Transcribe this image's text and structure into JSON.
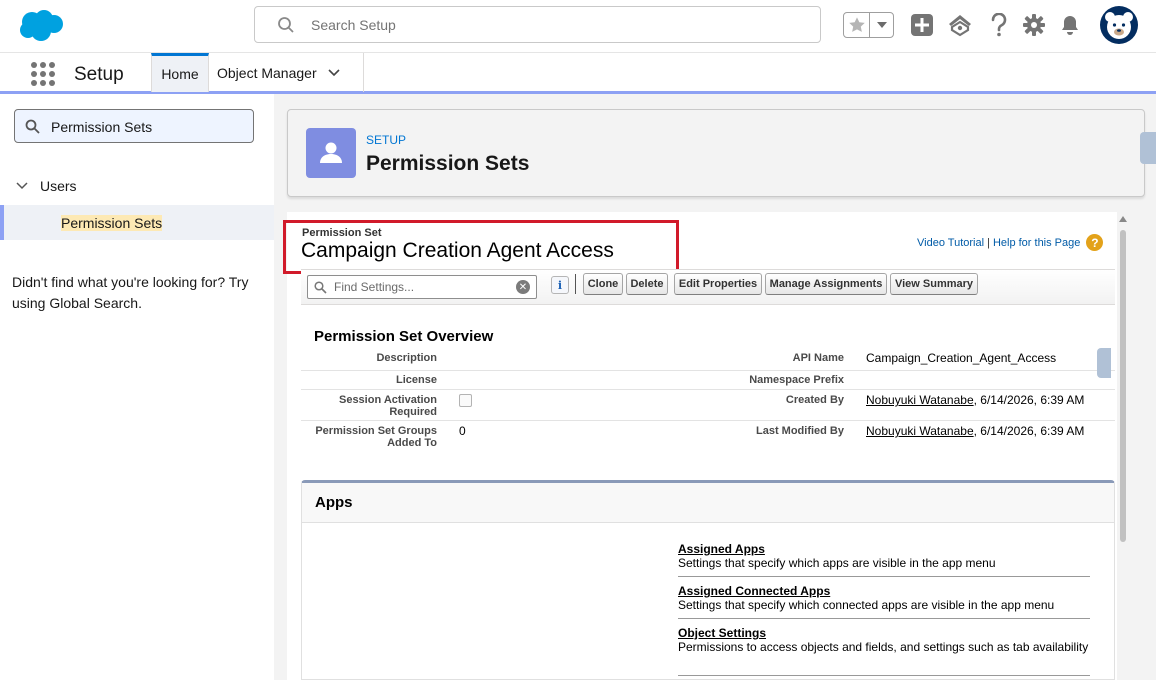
{
  "header": {
    "search_placeholder": "Search Setup",
    "icons": [
      "salesforce-logo",
      "search-icon",
      "star-icon",
      "caret-down-icon",
      "plus-icon",
      "trailhead-icon",
      "help-icon",
      "gear-icon",
      "bell-icon",
      "avatar"
    ],
    "brand_color": "#0176d3"
  },
  "context": {
    "app_name": "Setup",
    "tabs": [
      {
        "label": "Home"
      },
      {
        "label": "Object Manager"
      }
    ]
  },
  "sidebar": {
    "quickfind_value": "Permission Sets",
    "tree": {
      "group": "Users",
      "item": "Permission Sets"
    },
    "not_found": "Didn't find what you're looking for? Try using Global Search."
  },
  "page_header": {
    "eyebrow": "SETUP",
    "title": "Permission Sets"
  },
  "detail": {
    "type_label": "Permission Set",
    "name": "Campaign Creation Agent Access",
    "help": {
      "video": "Video Tutorial",
      "separator": "|",
      "help_page": "Help for this Page",
      "q_mark": "?"
    },
    "toolbar": {
      "find_placeholder": "Find Settings...",
      "info": "i",
      "clear": "✕",
      "buttons": {
        "clone": "Clone",
        "delete": "Delete",
        "edit": "Edit Properties",
        "manage": "Manage Assignments",
        "summary": "View Summary"
      }
    },
    "overview": {
      "title": "Permission Set Overview",
      "description_label": "Description",
      "license_label": "License",
      "session_label_1": "Session Activation",
      "session_label_2": "Required",
      "groups_label_1": "Permission Set Groups",
      "groups_label_2": "Added To",
      "groups_value": "0",
      "api_name_label": "API Name",
      "api_name_value": "Campaign_Creation_Agent_Access",
      "namespace_label": "Namespace Prefix",
      "created_by_label": "Created By",
      "created_by_user": "Nobuyuki Watanabe",
      "created_by_date": ", 6/14/2026, 6:39 AM",
      "modified_by_label": "Last Modified By",
      "modified_by_user": "Nobuyuki Watanabe",
      "modified_by_date": ", 6/14/2026, 6:39 AM"
    },
    "apps": {
      "title": "Apps",
      "items": [
        {
          "label": "Assigned Apps",
          "desc": "Settings that specify which apps are visible in the app menu"
        },
        {
          "label": "Assigned Connected Apps",
          "desc": "Settings that specify which connected apps are visible in the app menu"
        },
        {
          "label": "Object Settings",
          "desc": "Permissions to access objects and fields, and settings such as tab availability"
        }
      ]
    }
  }
}
